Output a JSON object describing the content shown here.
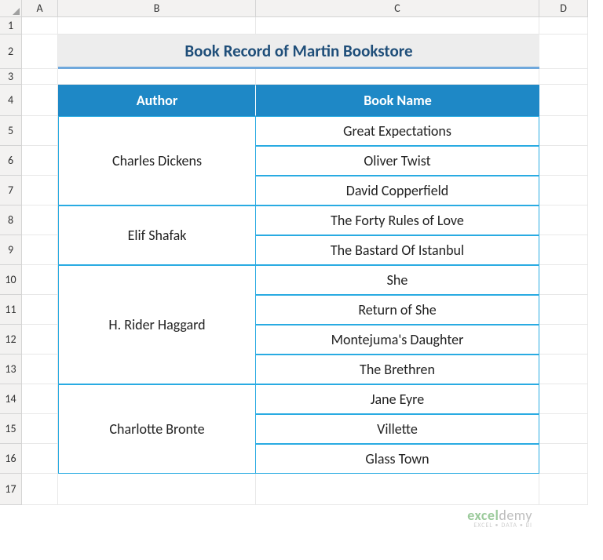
{
  "columns": [
    "A",
    "B",
    "C",
    "D"
  ],
  "rows": [
    "1",
    "2",
    "3",
    "4",
    "5",
    "6",
    "7",
    "8",
    "9",
    "10",
    "11",
    "12",
    "13",
    "14",
    "15",
    "16",
    "17"
  ],
  "title": "Book Record of Martin Bookstore",
  "headers": {
    "author": "Author",
    "book": "Book Name"
  },
  "authors": [
    "Charles Dickens",
    "Elif Shafak",
    "H. Rider Haggard",
    "Charlotte Bronte"
  ],
  "books": [
    "Great Expectations",
    "Oliver Twist",
    "David Copperfield",
    "The Forty Rules of Love",
    "The Bastard Of Istanbul",
    "She",
    "Return of She",
    "Montejuma's Daughter",
    "The Brethren",
    "Jane Eyre",
    "Villette",
    "Glass Town"
  ],
  "watermark": {
    "brand1": "excel",
    "brand2": "demy",
    "tag": "EXCEL • DATA • BI"
  }
}
